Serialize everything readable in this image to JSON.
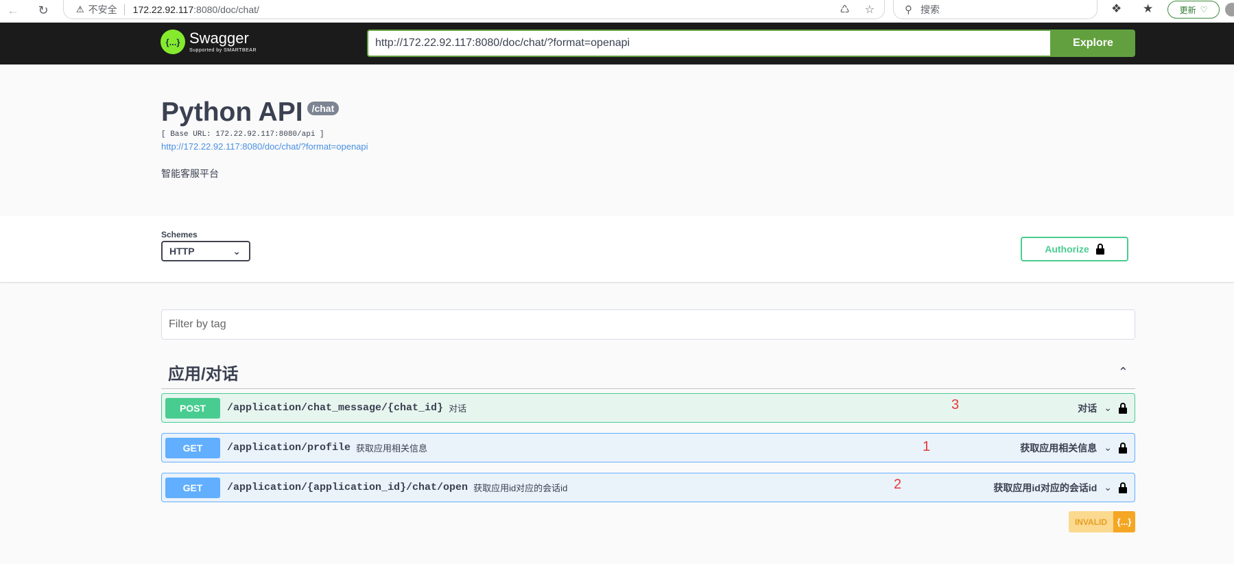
{
  "browser": {
    "back_icon": "arrow-left",
    "reload_icon": "reload",
    "security_warning": "不安全",
    "url_host": "172.22.92.117",
    "url_rest": ":8080/doc/chat/",
    "search_placeholder": "搜索",
    "update_label": "更新"
  },
  "topbar": {
    "logo_mark": "{...}",
    "logo_text": "Swagger",
    "logo_sub": "Supported by SMARTBEAR",
    "spec_url": "http://172.22.92.117:8080/doc/chat/?format=openapi",
    "explore_label": "Explore",
    "accent_color": "#62a03f"
  },
  "info": {
    "title": "Python API",
    "version_badge": "/chat",
    "base_url": "[ Base URL: 172.22.92.117:8080/api ]",
    "spec_link": "http://172.22.92.117:8080/doc/chat/?format=openapi",
    "description": "智能客服平台"
  },
  "schemes": {
    "label": "Schemes",
    "selected": "HTTP",
    "authorize_label": "Authorize"
  },
  "filter": {
    "placeholder": "Filter by tag"
  },
  "tag": {
    "title": "应用/对话"
  },
  "operations": [
    {
      "method": "POST",
      "path": "/application/chat_message/{chat_id}",
      "summary": "对话",
      "right_label": "对话",
      "color": "#49cc90"
    },
    {
      "method": "GET",
      "path": "/application/profile",
      "summary": "获取应用相关信息",
      "right_label": "获取应用相关信息",
      "color": "#61affe"
    },
    {
      "method": "GET",
      "path": "/application/{application_id}/chat/open",
      "summary": "获取应用id对应的会话id",
      "right_label": "获取应用id对应的会话id",
      "color": "#61affe"
    }
  ],
  "annotations": [
    "3",
    "1",
    "2"
  ],
  "validator": {
    "label": "INVALID",
    "icon": "{...}"
  }
}
